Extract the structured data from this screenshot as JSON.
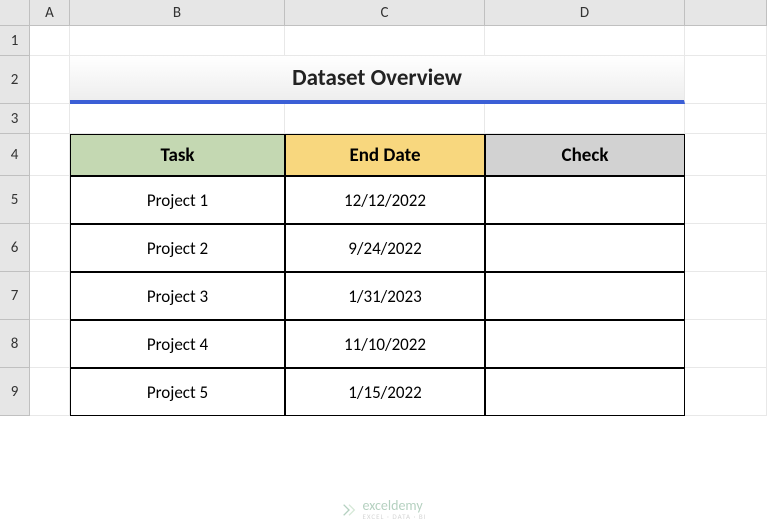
{
  "columns": [
    "A",
    "B",
    "C",
    "D"
  ],
  "rows": [
    "1",
    "2",
    "3",
    "4",
    "5",
    "6",
    "7",
    "8",
    "9"
  ],
  "title": "Dataset Overview",
  "headers": {
    "task": "Task",
    "end_date": "End Date",
    "check": "Check"
  },
  "data": [
    {
      "task": "Project 1",
      "end_date": "12/12/2022",
      "check": ""
    },
    {
      "task": "Project 2",
      "end_date": "9/24/2022",
      "check": ""
    },
    {
      "task": "Project 3",
      "end_date": "1/31/2023",
      "check": ""
    },
    {
      "task": "Project 4",
      "end_date": "11/10/2022",
      "check": ""
    },
    {
      "task": "Project 5",
      "end_date": "1/15/2022",
      "check": ""
    }
  ],
  "watermark": {
    "main": "exceldemy",
    "sub": "EXCEL · DATA · BI"
  }
}
